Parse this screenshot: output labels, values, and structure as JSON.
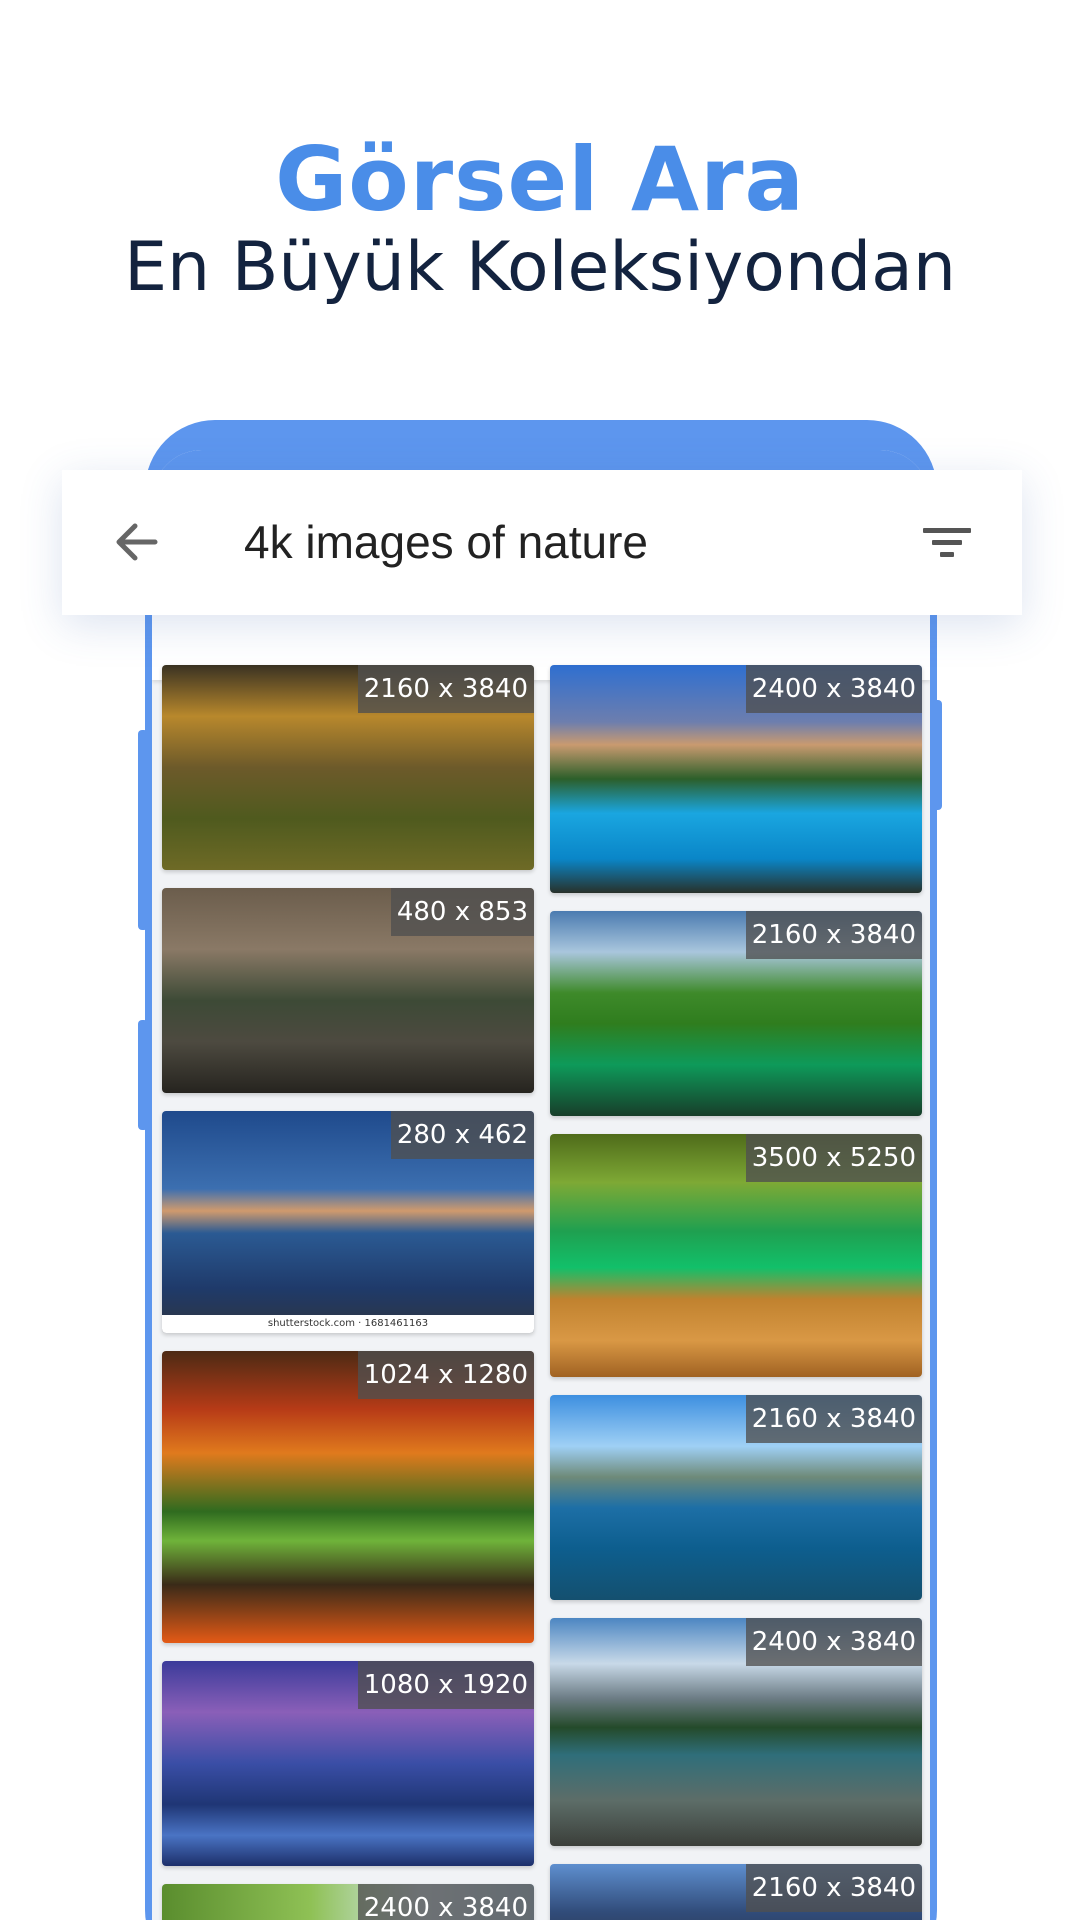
{
  "headline": {
    "title": "Görsel Ara",
    "subtitle": "En Büyük Koleksiyondan"
  },
  "search": {
    "query": "4k images of nature"
  },
  "icons": {
    "back": "arrow-left-icon",
    "filter": "filter-icon"
  },
  "colors": {
    "accent": "#4a8de8",
    "phone_frame": "#5d96ee",
    "subtitle": "#13233f"
  },
  "results": {
    "left": [
      {
        "size": "2160 x 3840"
      },
      {
        "size": "480 x 853"
      },
      {
        "size": "280 x 462",
        "caption": "shutterstock.com · 1681461163"
      },
      {
        "size": "1024 x 1280"
      },
      {
        "size": "1080 x 1920"
      },
      {
        "size": "2400 x 3840"
      }
    ],
    "right": [
      {
        "size": "2400 x 3840"
      },
      {
        "size": "2160 x 3840"
      },
      {
        "size": "3500 x 5250"
      },
      {
        "size": "2160 x 3840"
      },
      {
        "size": "2400 x 3840"
      },
      {
        "size": "2160 x 3840"
      }
    ]
  }
}
